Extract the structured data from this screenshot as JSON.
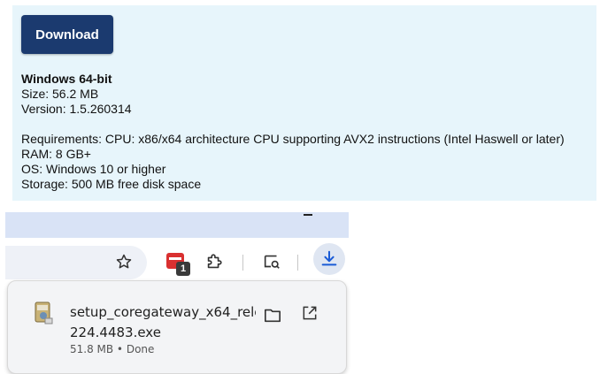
{
  "download_card": {
    "button_label": "Download",
    "platform": "Windows 64-bit",
    "size": "Size: 56.2 MB",
    "version": "Version: 1.5.260314",
    "requirements": [
      "Requirements: CPU: x86/x64 architecture CPU supporting AVX2 instructions (Intel Haswell or later)",
      "RAM: 8 GB+",
      "OS: Windows 10 or higher",
      "Storage: 500 MB free disk space"
    ],
    "background": "#e7f5fb",
    "button_color": "#1b3a6f"
  },
  "toolbar": {
    "extension_badge": "1",
    "icons": [
      "bookmark-star-icon",
      "extension-red-icon",
      "puzzle-icon",
      "lens-icon",
      "download-icon"
    ]
  },
  "download_item": {
    "filename_line1": "setup_coregateway_x64_rele",
    "filename_line2": "224.4483.exe",
    "status": "51.8 MB • Done"
  }
}
